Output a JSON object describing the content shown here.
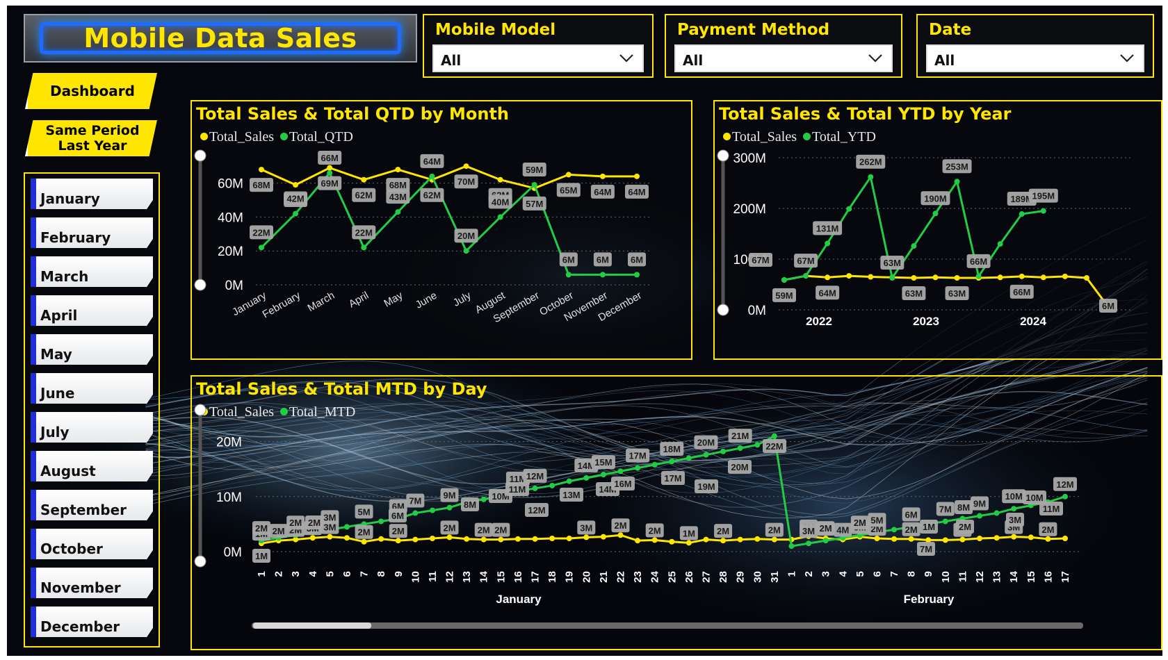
{
  "title": "Mobile Data Sales",
  "nav": {
    "dashboard": "Dashboard",
    "same_period": "Same Period Last Year"
  },
  "months": [
    "January",
    "February",
    "March",
    "April",
    "May",
    "June",
    "July",
    "August",
    "September",
    "October",
    "November",
    "December"
  ],
  "filters": [
    {
      "label": "Mobile Model",
      "value": "All"
    },
    {
      "label": "Payment Method",
      "value": "All"
    },
    {
      "label": "Date",
      "value": "All"
    }
  ],
  "colors": {
    "accent": "#ffe600",
    "sales": "#ffe600",
    "running": "#22cc44",
    "month_tab": "#1e2fd8"
  },
  "icons": {
    "dropdown": "chevron-down-icon"
  },
  "chart_data": [
    {
      "type": "line",
      "title": "Total Sales & Total QTD by Month",
      "categories": [
        "January",
        "February",
        "March",
        "April",
        "May",
        "June",
        "July",
        "August",
        "September",
        "October",
        "November",
        "December"
      ],
      "yticks": [
        "0M",
        "20M",
        "40M",
        "60M"
      ],
      "ylim": [
        0,
        75
      ],
      "series": [
        {
          "name": "Total_Sales",
          "color": "#ffe600",
          "values": [
            68,
            59,
            69,
            62,
            68,
            62,
            70,
            62,
            57,
            65,
            64,
            64
          ],
          "labels": [
            "68M",
            "59M",
            "69M",
            "62M",
            "68M",
            "62M",
            "70M",
            "62M",
            "57M",
            "65M",
            "64M",
            "64M"
          ]
        },
        {
          "name": "Total_QTD",
          "color": "#22cc44",
          "values": [
            22,
            42,
            66,
            22,
            43,
            64,
            20,
            40,
            59,
            6,
            6,
            6
          ],
          "labels": [
            "22M",
            "42M",
            "66M",
            "22M",
            "43M",
            "64M",
            "20M",
            "40M",
            "59M",
            "6M",
            "6M",
            "6M"
          ]
        }
      ]
    },
    {
      "type": "line",
      "title": "Total Sales & Total YTD by Year",
      "groups": [
        "2022",
        "2023",
        "2024"
      ],
      "yticks": [
        "0M",
        "100M",
        "200M",
        "300M"
      ],
      "ylim": [
        0,
        300
      ],
      "series": [
        {
          "name": "Total_Sales",
          "color": "#ffe600",
          "values": [
            59,
            67,
            64,
            67,
            65,
            64,
            63,
            64,
            63,
            63,
            64,
            66,
            64,
            66,
            63,
            6
          ],
          "labels": [
            "59M",
            "",
            "64M",
            "",
            "",
            "",
            "63M",
            "",
            "63M",
            "",
            "",
            "66M",
            "",
            "",
            "",
            ""
          ]
        },
        {
          "name": "Total_YTD",
          "color": "#22cc44",
          "values": [
            59,
            67,
            131,
            199,
            262,
            63,
            126,
            190,
            253,
            66,
            130,
            189,
            195,
            null,
            null,
            null
          ],
          "labels": [
            "",
            "67M",
            "131M",
            "",
            "262M",
            "63M",
            "",
            "190M",
            "253M",
            "66M",
            "",
            "189M",
            "195M",
            "",
            "",
            ""
          ]
        }
      ],
      "extra_labels": [
        "67M",
        "6M"
      ]
    },
    {
      "type": "line",
      "title": "Total Sales & Total MTD by Day",
      "groups": [
        "January",
        "February"
      ],
      "x": [
        "1",
        "2",
        "3",
        "4",
        "5",
        "6",
        "7",
        "8",
        "9",
        "10",
        "11",
        "12",
        "13",
        "14",
        "15",
        "16",
        "17",
        "18",
        "19",
        "20",
        "21",
        "22",
        "23",
        "24",
        "25",
        "26",
        "27",
        "28",
        "29",
        "30",
        "31",
        "1",
        "2",
        "3",
        "4",
        "5",
        "6",
        "7",
        "8",
        "9",
        "10",
        "11",
        "12",
        "13",
        "14",
        "15",
        "16",
        "17"
      ],
      "yticks": [
        "0M",
        "10M",
        "20M"
      ],
      "ylim": [
        0,
        25
      ],
      "series": [
        {
          "name": "Total_Sales",
          "color": "#ffe600",
          "values": [
            1.5,
            2,
            2.2,
            2.5,
            2.7,
            2.5,
            1.8,
            2.3,
            2,
            2.2,
            2.4,
            2.6,
            2.3,
            2.2,
            2.2,
            2.3,
            2.3,
            2.4,
            2.4,
            2.6,
            2.7,
            3,
            2,
            2.1,
            1.8,
            1.6,
            2.2,
            2,
            2.2,
            2.3,
            2.2,
            2.2,
            2.8,
            2.4,
            2.2,
            2.7,
            2.4,
            2.3,
            2.3,
            2.1,
            2.1,
            2.2,
            2.4,
            2.5,
            2.7,
            2.6,
            2.3,
            2.4
          ],
          "labels": [
            "1M",
            "2M",
            "2M",
            "3M",
            "3M",
            "",
            "2M",
            "",
            "2M",
            "",
            "",
            "2M",
            "",
            "2M",
            "2M",
            "",
            "",
            "",
            "",
            "3M",
            "",
            "2M",
            "",
            "2M",
            "",
            "1M",
            "",
            "2M",
            "",
            "",
            "2M",
            "",
            "2M",
            "2M",
            "4M",
            "3M",
            "2M",
            "",
            "2M",
            "",
            "",
            "2M",
            "",
            "",
            "3M",
            "",
            "2M",
            ""
          ]
        },
        {
          "name": "Total_MTD",
          "color": "#22cc44",
          "values": [
            2,
            2.5,
            3,
            3.5,
            4,
            4.5,
            5,
            5.5,
            6,
            7,
            7.5,
            8,
            9,
            9.5,
            10,
            11,
            11.5,
            12,
            12.8,
            13.4,
            14,
            14.6,
            15.2,
            15.8,
            16.4,
            17,
            17.6,
            18.2,
            18.8,
            19.4,
            21,
            1,
            1.5,
            2,
            2.5,
            3,
            3.5,
            4,
            4.5,
            5,
            5.5,
            6,
            6.5,
            7,
            7.8,
            8.4,
            9,
            10
          ],
          "labels": [
            "2M",
            "",
            "2M",
            "",
            "3M",
            "",
            "5M",
            "",
            "6M",
            "7M",
            "",
            "9M",
            "",
            "",
            "",
            "11M",
            "12M",
            "",
            "",
            "14M",
            "15M",
            "",
            "17M",
            "",
            "18M",
            "",
            "20M",
            "",
            "21M",
            "",
            "",
            "",
            "3M",
            "2M",
            "",
            "2M",
            "5M",
            "",
            "6M",
            "",
            "7M",
            "",
            "9M",
            "",
            "10M",
            "",
            "",
            "12M"
          ]
        }
      ],
      "extra_labels": [
        "1M",
        "2M",
        "6M",
        "8M",
        "10M",
        "11M",
        "12M",
        "13M",
        "14M",
        "16M",
        "17M",
        "19M",
        "20M",
        "22M",
        "7M",
        "1M",
        "8M",
        "10M",
        "11M",
        "2M",
        "3M"
      ]
    }
  ]
}
